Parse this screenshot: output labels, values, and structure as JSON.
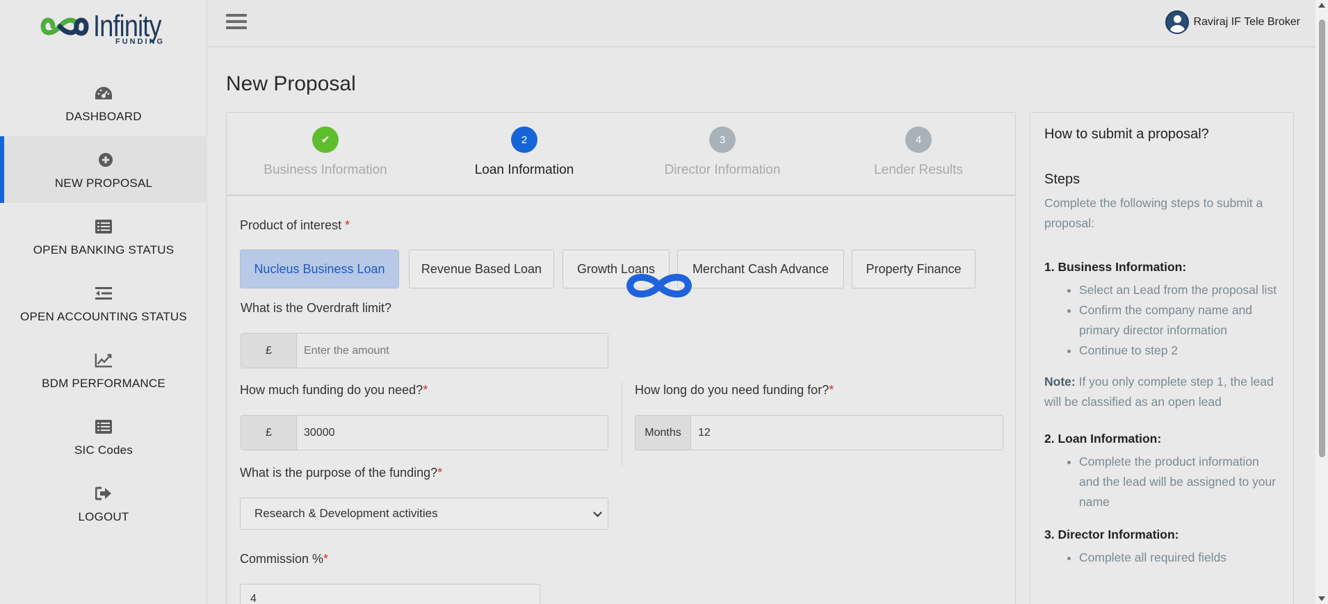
{
  "brand": {
    "name": "Infinity",
    "sub": "FUNDING"
  },
  "sidebar": {
    "items": [
      {
        "label": "DASHBOARD",
        "icon": "dashboard-gauge-icon"
      },
      {
        "label": "NEW PROPOSAL",
        "icon": "plus-circle-icon",
        "active": true
      },
      {
        "label": "OPEN BANKING STATUS",
        "icon": "list-card-icon"
      },
      {
        "label": "OPEN ACCOUNTING STATUS",
        "icon": "indent-list-icon"
      },
      {
        "label": "BDM PERFORMANCE",
        "icon": "line-chart-icon"
      },
      {
        "label": "SIC Codes",
        "icon": "list-card-icon"
      },
      {
        "label": "LOGOUT",
        "icon": "sign-out-icon"
      }
    ]
  },
  "header": {
    "user_name": "Raviraj IF Tele Broker"
  },
  "page": {
    "title": "New Proposal"
  },
  "steps": [
    {
      "number": "✔",
      "label": "Business Information",
      "state": "complete",
      "color": "#5ebd2c"
    },
    {
      "number": "2",
      "label": "Loan Information",
      "state": "current",
      "color": "#1565d8"
    },
    {
      "number": "3",
      "label": "Director Information",
      "state": "pending",
      "color": "#a8b2b8"
    },
    {
      "number": "4",
      "label": "Lender Results",
      "state": "pending",
      "color": "#a8b2b8"
    }
  ],
  "form": {
    "product_label": "Product of interest",
    "products": [
      {
        "label": "Nucleus Business Loan",
        "selected": true
      },
      {
        "label": "Revenue Based Loan",
        "selected": false
      },
      {
        "label": "Growth Loans",
        "selected": false
      },
      {
        "label": "Merchant Cash Advance",
        "selected": false
      },
      {
        "label": "Property Finance",
        "selected": false
      }
    ],
    "overdraft_label": "What is the Overdraft limit?",
    "overdraft_prefix": "£",
    "overdraft_placeholder": "Enter the amount",
    "overdraft_value": "",
    "funding_amount_label": "How much funding do you need?",
    "funding_amount_prefix": "£",
    "funding_amount_value": "30000",
    "funding_term_label": "How long do you need funding for?",
    "funding_term_prefix": "Months",
    "funding_term_value": "12",
    "purpose_label": "What is the purpose of the funding?",
    "purpose_value": "Research & Development activities",
    "commission_label": "Commission %",
    "commission_value": "4",
    "required_mark": "*"
  },
  "help": {
    "title": "How to submit a proposal?",
    "steps_heading": "Steps",
    "intro": "Complete the following steps to submit a proposal:",
    "sections": [
      {
        "heading": "1. Business Information:",
        "items": [
          "Select an Lead from the proposal list",
          "Confirm the company name and primary director information",
          "Continue to step 2"
        ]
      },
      {
        "heading": "2. Loan Information:",
        "items": [
          "Complete the product information and the lead will be assigned to your name"
        ]
      },
      {
        "heading": "3. Director Information:",
        "items": [
          "Complete all required fields"
        ]
      }
    ],
    "note_label": "Note:",
    "note_text": " If you only complete step 1, the lead will be classified as an open lead"
  },
  "colors": {
    "accent": "#1565d8",
    "success": "#5ebd2c",
    "required": "#d32f2f"
  }
}
